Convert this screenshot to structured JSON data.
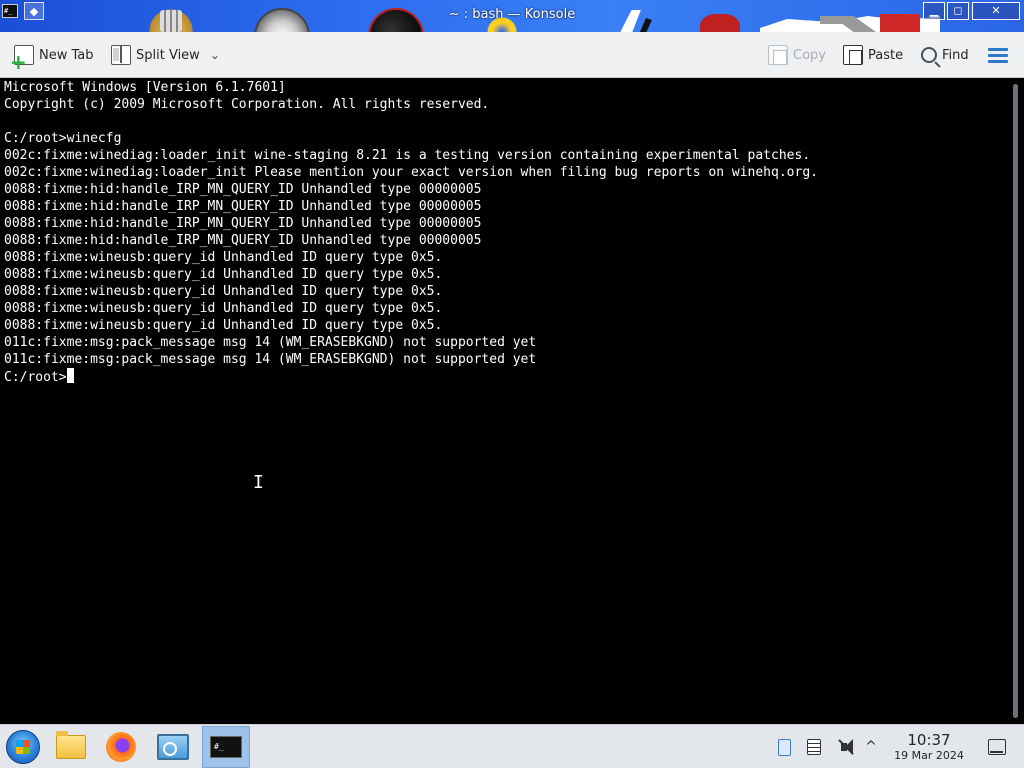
{
  "window": {
    "title": "~ : bash — Konsole",
    "app_icon_text": "#_",
    "menu_glyph": "◆",
    "minimize_glyph": "▁",
    "maximize_glyph": "◻",
    "close_glyph": "✕"
  },
  "toolbar": {
    "new_tab_label": "New Tab",
    "split_view_label": "Split View",
    "split_view_chevron": "⌄",
    "copy_label": "Copy",
    "paste_label": "Paste",
    "find_label": "Find",
    "copy_enabled": false,
    "accent_color": "#2d79c7"
  },
  "terminal": {
    "lines": [
      "Microsoft Windows [Version 6.1.7601]",
      "Copyright (c) 2009 Microsoft Corporation. All rights reserved.",
      "",
      "C:/root>winecfg",
      "002c:fixme:winediag:loader_init wine-staging 8.21 is a testing version containing experimental patches.",
      "002c:fixme:winediag:loader_init Please mention your exact version when filing bug reports on winehq.org.",
      "0088:fixme:hid:handle_IRP_MN_QUERY_ID Unhandled type 00000005",
      "0088:fixme:hid:handle_IRP_MN_QUERY_ID Unhandled type 00000005",
      "0088:fixme:hid:handle_IRP_MN_QUERY_ID Unhandled type 00000005",
      "0088:fixme:hid:handle_IRP_MN_QUERY_ID Unhandled type 00000005",
      "0088:fixme:wineusb:query_id Unhandled ID query type 0x5.",
      "0088:fixme:wineusb:query_id Unhandled ID query type 0x5.",
      "0088:fixme:wineusb:query_id Unhandled ID query type 0x5.",
      "0088:fixme:wineusb:query_id Unhandled ID query type 0x5.",
      "0088:fixme:wineusb:query_id Unhandled ID query type 0x5.",
      "011c:fixme:msg:pack_message msg 14 (WM_ERASEBKGND) not supported yet",
      "011c:fixme:msg:pack_message msg 14 (WM_ERASEBKGND) not supported yet"
    ],
    "prompt": "C:/root>",
    "background_color": "#000000",
    "text_color": "#ffffff"
  },
  "taskbar": {
    "konsole_icon_text": "#_",
    "expand_glyph": "^",
    "clock_time": "10:37",
    "clock_date": "19 Mar 2024",
    "volume_muted": true
  }
}
